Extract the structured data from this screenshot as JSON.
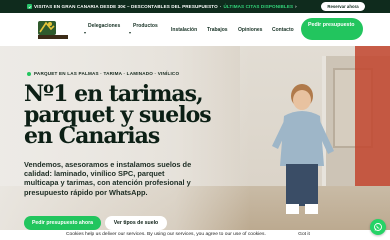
{
  "topbar": {
    "message_part1": "VISITAS EN GRAN CANARIA DESDE 30€ – DESCONTABLES DEL PRESUPUESTO",
    "message_part2": "ÚLTIMAS CITAS DISPONIBLES",
    "button_label": "Reservar ahora"
  },
  "nav": {
    "logo_text": "Parquets",
    "items": [
      {
        "label": "Delegaciones"
      },
      {
        "label": "Productos"
      },
      {
        "label": "Instalación"
      },
      {
        "label": "Trabajos"
      },
      {
        "label": "Opiniones"
      },
      {
        "label": "Contacto"
      }
    ],
    "cta_label": "Pedir presupuesto"
  },
  "hero": {
    "tag": "PARQUET EN LAS PALMAS · TARIMA · LAMINADO · VINÍLICO",
    "title": "Nº1 en tarimas, parquet y suelos en Canarias",
    "subtitle": "Vendemos, asesoramos e instalamos suelos de calidad: laminado, vinílico SPC, parquet multicapa y tarimas, con atención profesional y presupuesto rápido por WhatsApp.",
    "primary_button": "Pedir presupuesto ahora",
    "secondary_button": "Ver tipos de suelo"
  },
  "cookie": {
    "text": "Cookies help us deliver our services. By using our services, you agree to our use of cookies.",
    "button": "Got it"
  },
  "colors": {
    "accent": "#22c55e",
    "dark": "#0f2b1d"
  }
}
